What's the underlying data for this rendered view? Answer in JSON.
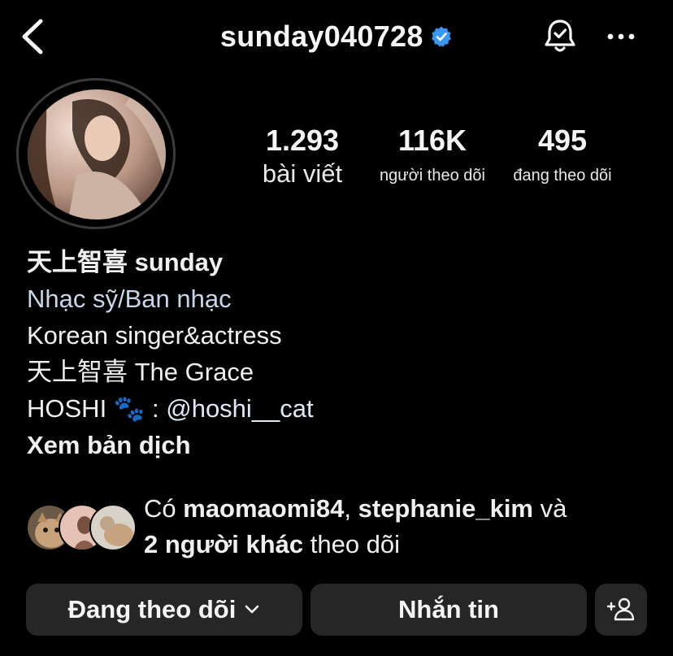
{
  "header": {
    "username": "sunday040728",
    "verified_color": "#3897f0"
  },
  "stats": {
    "posts": {
      "value": "1.293",
      "label": "bài viết"
    },
    "followers": {
      "value": "116K",
      "label": "người theo dõi"
    },
    "following": {
      "value": "495",
      "label": "đang theo dõi"
    }
  },
  "bio": {
    "name": "天上智喜 sunday",
    "category": "Nhạc sỹ/Ban nhạc",
    "line1": "Korean singer&actress",
    "line2": "天上智喜 The Grace",
    "line3_prefix": "HOSHI 🐾 : ",
    "line3_mention": "@hoshi__cat",
    "translate": "Xem bản dịch"
  },
  "followed_by": {
    "prefix": "Có ",
    "user1": "maomaomi84",
    "sep": ", ",
    "user2": "stephanie_kim",
    "and": " và ",
    "others": "2 người khác",
    "suffix": " theo dõi"
  },
  "actions": {
    "following_label": "Đang theo dõi",
    "message_label": "Nhắn tin"
  },
  "icons": {
    "back": "chevron-left-icon",
    "verified": "verified-badge-icon",
    "notifications": "bell-check-icon",
    "more": "more-horizontal-icon",
    "add_person": "add-person-icon",
    "dropdown": "chevron-down-icon"
  }
}
